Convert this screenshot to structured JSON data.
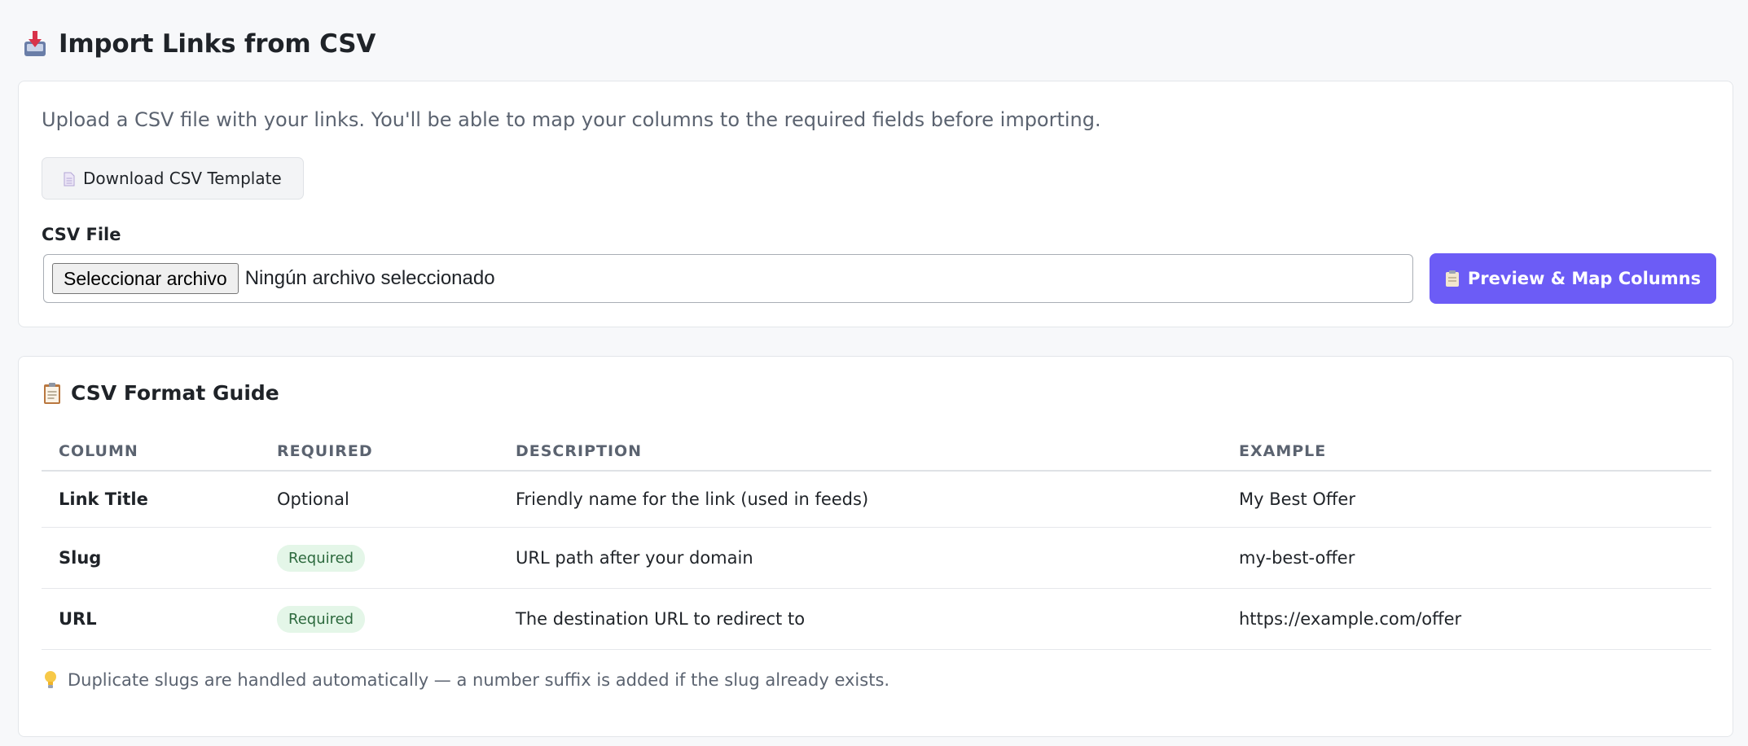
{
  "header": {
    "title": "Import Links from CSV",
    "icon": "inbox-tray-icon"
  },
  "upload": {
    "intro": "Upload a CSV file with your links. You'll be able to map your columns to the required fields before importing.",
    "download_template_label": "Download CSV Template",
    "csv_file_label": "CSV File",
    "file_button_label": "Seleccionar archivo",
    "file_status": "Ningún archivo seleccionado",
    "preview_button_label": "Preview & Map Columns",
    "accent_color": "#6c5cf6"
  },
  "guide": {
    "title": "CSV Format Guide",
    "columns": [
      "COLUMN",
      "REQUIRED",
      "DESCRIPTION",
      "EXAMPLE"
    ],
    "rows": [
      {
        "column": "Link Title",
        "required": "Optional",
        "description": "Friendly name for the link (used in feeds)",
        "example": "My Best Offer"
      },
      {
        "column": "Slug",
        "required": "Required",
        "description": "URL path after your domain",
        "example": "my-best-offer"
      },
      {
        "column": "URL",
        "required": "Required",
        "description": "The destination URL to redirect to",
        "example": "https://example.com/offer"
      }
    ],
    "hint": "Duplicate slugs are handled automatically — a number suffix is added if the slug already exists."
  }
}
